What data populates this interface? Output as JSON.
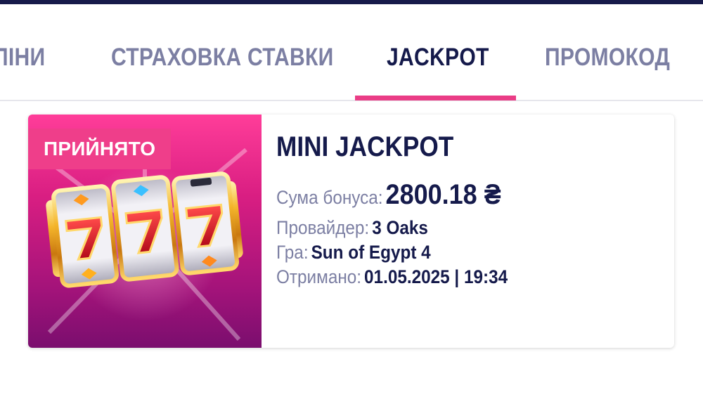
{
  "tabs": [
    {
      "label": "СПІНИ"
    },
    {
      "label": "СТРАХОВКА СТАВКИ"
    },
    {
      "label": "JACKPOT",
      "active": true
    },
    {
      "label": "ПРОМОКОД"
    }
  ],
  "colors": {
    "accent": "#ea3d86",
    "text_dark": "#151a4b",
    "text_muted": "#7c7fa3",
    "top_bar": "#171a4a"
  },
  "bonus_card": {
    "status": "ПРИЙНЯТО",
    "title": "MINI JACKPOT",
    "image_icon": "slot-777-reels-icon",
    "rows": [
      {
        "label": "Сума бонуса:",
        "value": "2800.18 ₴"
      },
      {
        "label": "Провайдер:",
        "value": "3 Oaks"
      },
      {
        "label": "Гра:",
        "value": "Sun of Egypt 4"
      },
      {
        "label": "Отримано:",
        "value": "01.05.2025 | 19:34"
      }
    ]
  }
}
